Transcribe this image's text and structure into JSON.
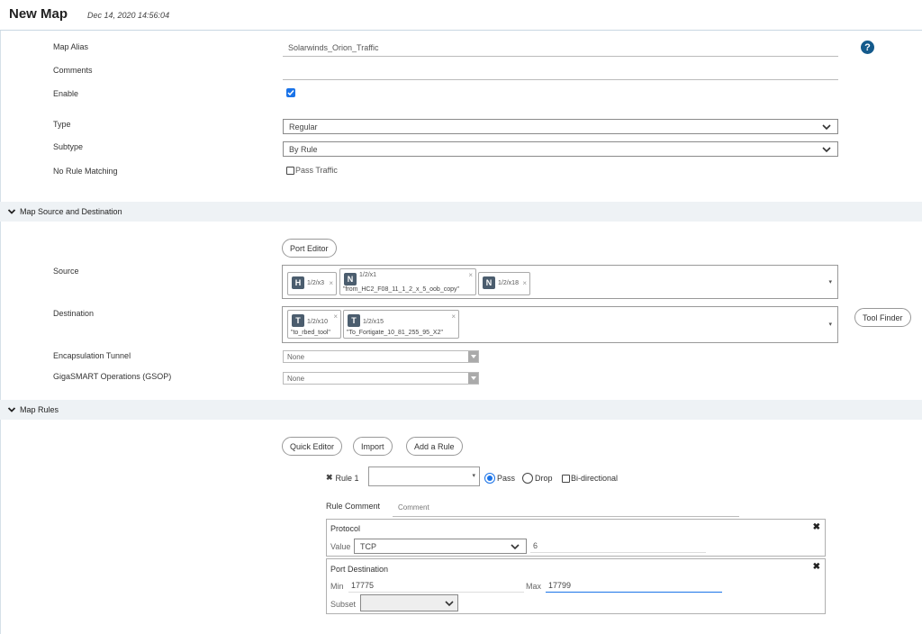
{
  "header": {
    "title": "New Map",
    "timestamp": "Dec 14, 2020 14:56:04"
  },
  "form": {
    "map_alias_label": "Map Alias",
    "map_alias_value": "Solarwinds_Orion_Traffic",
    "comments_label": "Comments",
    "comments_value": "",
    "enable_label": "Enable",
    "enable_checked": true,
    "type_label": "Type",
    "type_value": "Regular",
    "subtype_label": "Subtype",
    "subtype_value": "By Rule",
    "no_rule_label": "No Rule Matching",
    "pass_traffic_label": "Pass Traffic"
  },
  "source_section": {
    "title": "Map Source and Destination",
    "port_editor": "Port Editor",
    "source_label": "Source",
    "source_tags": [
      {
        "badge": "H",
        "port": "1/2/x3",
        "name": ""
      },
      {
        "badge": "N",
        "port": "1/2/x1",
        "name": "\"from_HC2_F08_11_1_2_x_5_oob_copy\""
      },
      {
        "badge": "N",
        "port": "1/2/x18",
        "name": ""
      }
    ],
    "destination_label": "Destination",
    "destination_tags": [
      {
        "badge": "T",
        "port": "1/2/x10",
        "name": "\"to_rbed_tool\""
      },
      {
        "badge": "T",
        "port": "1/2/x15",
        "name": "\"To_Fortigate_10_81_255_95_X2\""
      }
    ],
    "tool_finder": "Tool Finder",
    "encap_label": "Encapsulation Tunnel",
    "encap_value": "None",
    "gsop_label": "GigaSMART Operations (GSOP)",
    "gsop_value": "None"
  },
  "rules_section": {
    "title": "Map Rules",
    "quick_editor": "Quick Editor",
    "import": "Import",
    "add_rule": "Add a Rule",
    "rule_label": "Rule 1",
    "pass_label": "Pass",
    "drop_label": "Drop",
    "bidir_label": "Bi-directional",
    "rule_comment_label": "Rule Comment",
    "comment_placeholder": "Comment",
    "protocol": {
      "title": "Protocol",
      "value_label": "Value",
      "value": "TCP",
      "number": "6"
    },
    "port_destination": {
      "title": "Port Destination",
      "min_label": "Min",
      "min_value": "17775",
      "max_label": "Max",
      "max_value": "17799",
      "subset_label": "Subset"
    }
  },
  "colors": {
    "accent": "#1a73e8",
    "help": "#145a8c",
    "section_bg": "#eef2f5",
    "badge": "#4b5d6e"
  }
}
